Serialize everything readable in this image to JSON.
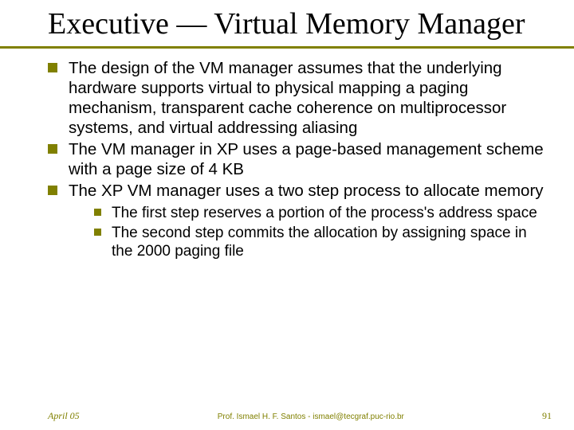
{
  "title": "Executive — Virtual Memory Manager",
  "bullets": [
    {
      "text": "The design of the VM manager assumes that the underlying hardware supports virtual to physical mapping a paging mechanism, transparent cache coherence on multiprocessor systems, and virtual addressing aliasing"
    },
    {
      "text": "The VM manager in XP uses a page-based management scheme with a page size of 4 KB"
    },
    {
      "text": "The XP VM manager uses a two step process to allocate memory",
      "sub": [
        {
          "text": "The first step reserves a portion of the process's address space"
        },
        {
          "text": "The second step commits the allocation by assigning space in the 2000 paging file"
        }
      ]
    }
  ],
  "footer": {
    "date": "April 05",
    "author": "Prof. Ismael H. F. Santos - ismael@tecgraf.puc-rio.br",
    "pagenum": "91"
  }
}
